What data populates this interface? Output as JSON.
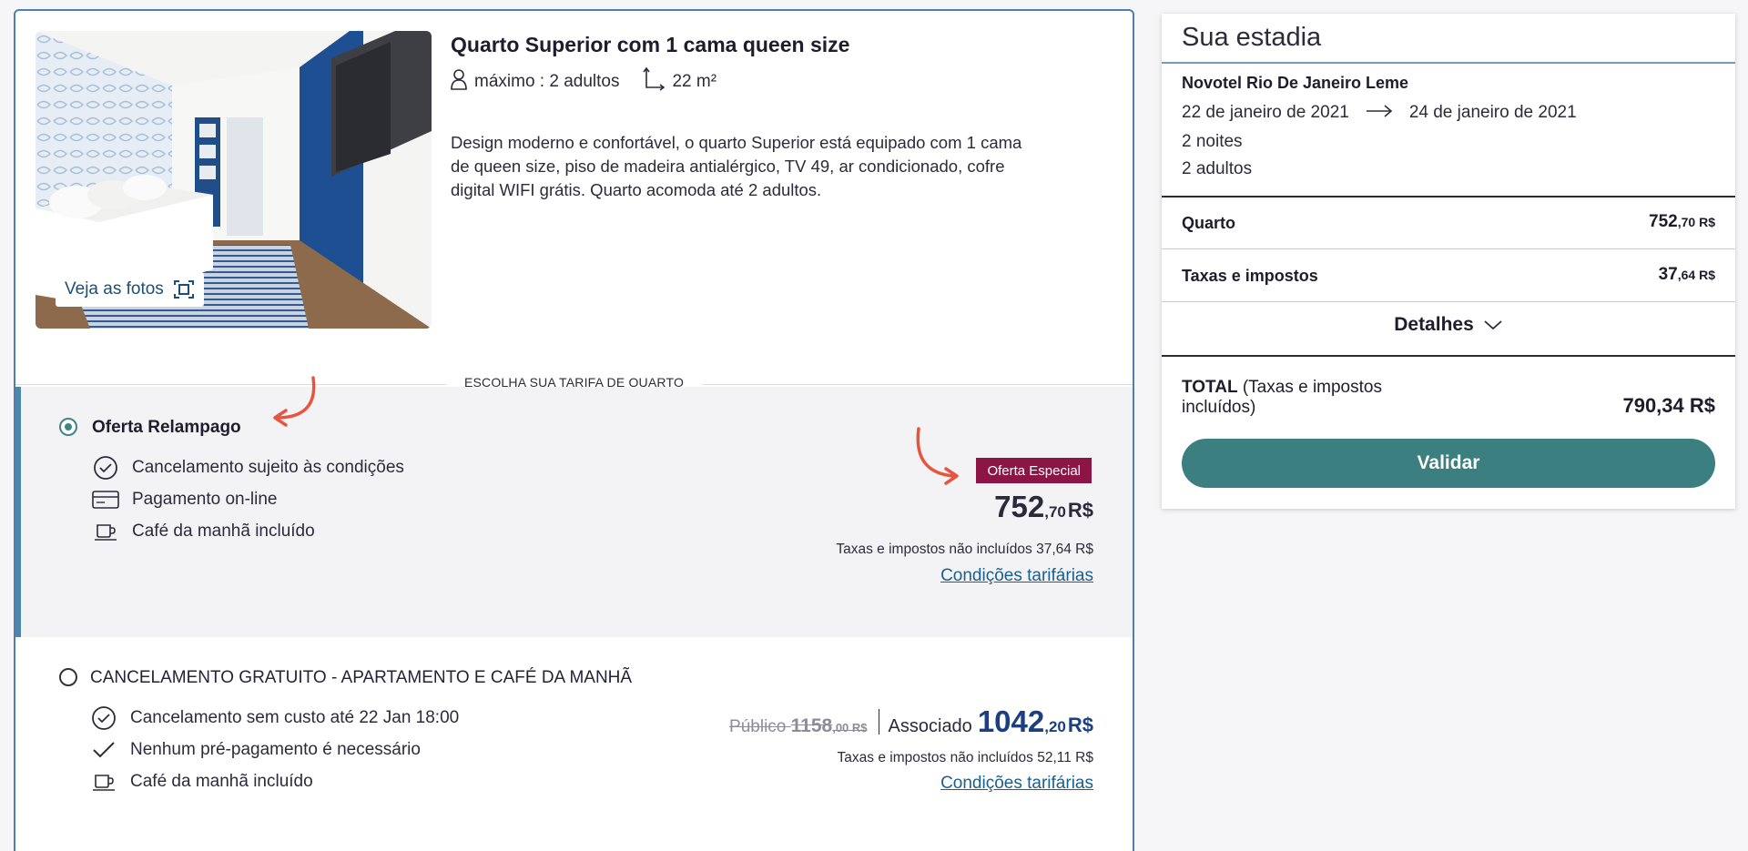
{
  "room": {
    "title": "Quarto Superior com 1 cama queen size",
    "max_guests": "máximo : 2 adultos",
    "size": "22 m²",
    "description": "Design moderno e confortável, o quarto Superior está equipado com 1 cama de queen size, piso de madeira antialérgico, TV 49, ar condicionado, cofre digital WIFI grátis. Quarto acomoda até 2 adultos.",
    "photos_button": "Veja as fotos"
  },
  "rates_header": "ESCOLHA SUA TARIFA DE QUARTO",
  "rates": [
    {
      "name": "Oferta Relampago",
      "selected": true,
      "features": [
        {
          "icon": "check-circle-icon",
          "text": "Cancelamento sujeito às condições"
        },
        {
          "icon": "credit-card-icon",
          "text": "Pagamento on-line"
        },
        {
          "icon": "coffee-cup-icon",
          "text": "Café da manhã incluído"
        }
      ],
      "badge": "Oferta Especial",
      "price_int": "752",
      "price_dec": ",70",
      "currency": "R$",
      "tax_note": "Taxas e impostos não incluídos 37,64 R$",
      "conditions_link": "Condições tarifárias"
    },
    {
      "name": "CANCELAMENTO GRATUITO - APARTAMENTO E CAFÉ DA MANHÃ",
      "selected": false,
      "features": [
        {
          "icon": "check-circle-icon",
          "text": "Cancelamento sem custo até 22 Jan 18:00"
        },
        {
          "icon": "checkmark-icon",
          "text": "Nenhum pré-pagamento é necessário"
        },
        {
          "icon": "coffee-cup-icon",
          "text": "Café da manhã incluído"
        }
      ],
      "public_label": "Público",
      "public_int": "1158",
      "public_dec": ",00 R$",
      "member_label": "Associado",
      "price_int": "1042",
      "price_dec": ",20",
      "currency": "R$",
      "tax_note": "Taxas e impostos não incluídos 52,11 R$",
      "conditions_link": "Condições tarifárias"
    }
  ],
  "summary": {
    "title": "Sua estadia",
    "hotel": "Novotel Rio De Janeiro Leme",
    "date_from": "22 de janeiro de 2021",
    "date_to": "24 de janeiro de 2021",
    "nights": "2 noites",
    "adults": "2 adultos",
    "room_label": "Quarto",
    "room_int": "752",
    "room_dec": ",70 R$",
    "tax_label": "Taxas e impostos",
    "tax_int": "37",
    "tax_dec": ",64 R$",
    "details_label": "Detalhes",
    "total_label_bold": "TOTAL",
    "total_label_rest": " (Taxas e impostos incluídos)",
    "total_value": "790,34 R$",
    "validate_button": "Validar"
  },
  "colors": {
    "accent_teal": "#3c7f80",
    "badge_bg": "#8b1545",
    "link_blue": "#1b5f8c",
    "member_price": "#1c3f80",
    "annotation_arrow": "#e8553e"
  }
}
